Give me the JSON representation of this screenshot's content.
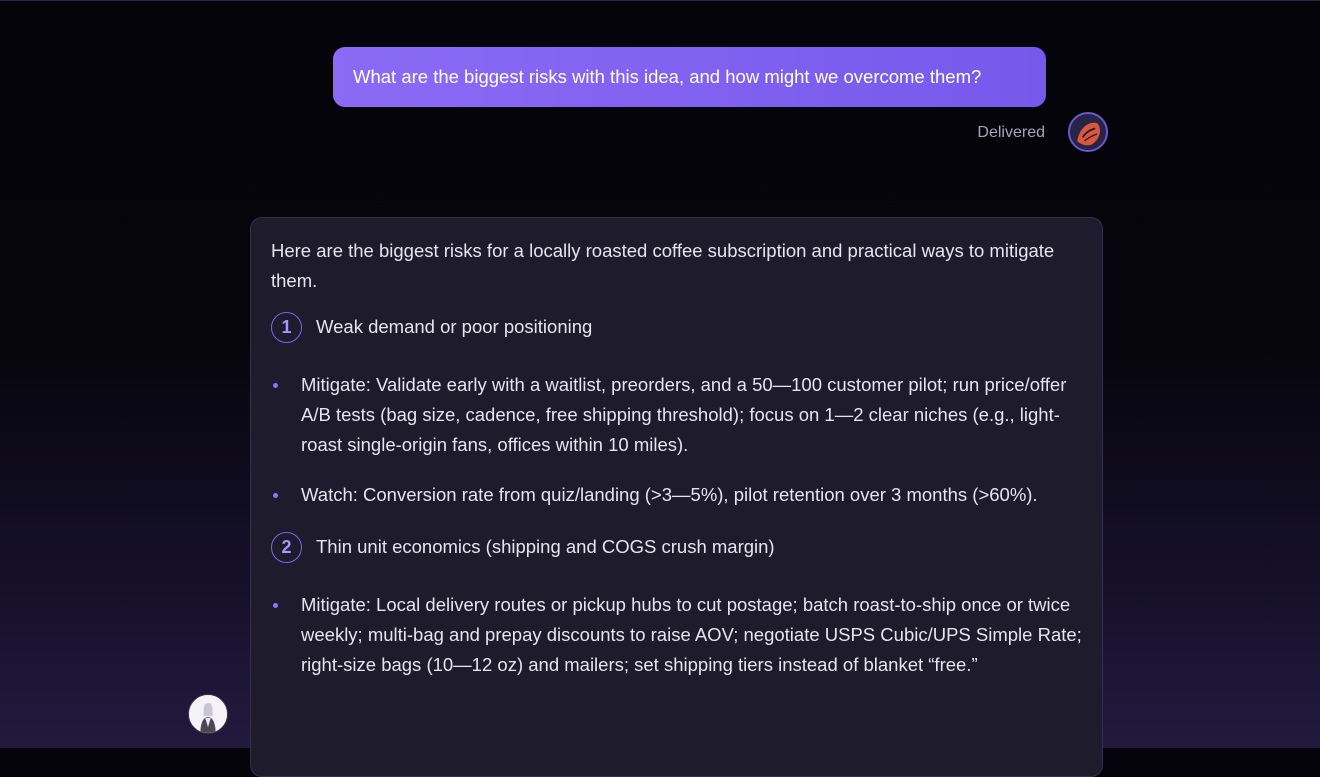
{
  "conversation": {
    "user_message": {
      "text": "What are the biggest risks with this idea, and how might we overcome them?",
      "status": "Delivered",
      "avatar_icon": "user-avatar-icon"
    },
    "assistant_message": {
      "intro": "Here are the biggest risks for a locally roasted coffee subscription and practical ways to mitigate them.",
      "avatar_icon": "assistant-avatar-icon",
      "sections": [
        {
          "number": "1",
          "title": "Weak demand or poor positioning",
          "bullets": [
            "Mitigate: Validate early with a waitlist, preorders, and a 50—100 customer pilot; run price/offer A/B tests (bag size, cadence, free shipping threshold); focus on 1—2 clear niches (e.g., light-roast single-origin fans, offices within 10 miles).",
            "Watch: Conversion rate from quiz/landing (>3—5%), pilot retention over 3 months (>60%)."
          ]
        },
        {
          "number": "2",
          "title": "Thin unit economics (shipping and COGS crush margin)",
          "bullets": [
            "Mitigate: Local delivery routes or pickup hubs to cut postage; batch roast-to-ship once or twice weekly; multi-bag and prepay discounts to raise AOV; negotiate USPS Cubic/UPS Simple Rate; right-size bags (10—12 oz) and mailers; set shipping tiers instead of blanket “free.”"
          ]
        }
      ]
    }
  },
  "colors": {
    "accent": "#7d62ee",
    "user_bubble": "#8b6bf5",
    "card_bg": "#1e1b2c"
  }
}
